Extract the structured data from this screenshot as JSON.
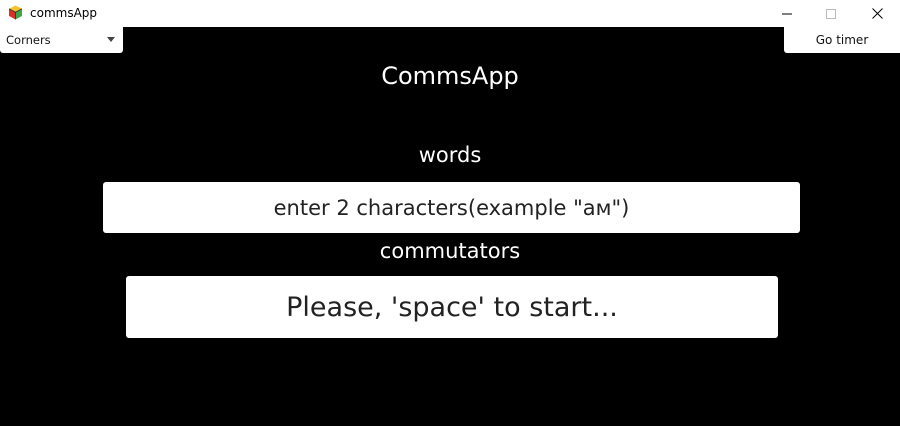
{
  "window": {
    "title": "commsApp",
    "icon": "app-cube-icon"
  },
  "toolbar": {
    "mode_select": {
      "selected": "Corners",
      "icon": "chevron-down-icon"
    },
    "timer_label": "Go timer"
  },
  "main": {
    "title": "CommsApp",
    "words_label": "words",
    "words_prompt": "enter 2 characters(example \"ам\")",
    "commutators_label": "commutators",
    "commutators_prompt": "Please, 'space' to start..."
  },
  "colors": {
    "background": "#000000",
    "panel": "#ffffff",
    "text_light": "#ffffff",
    "text_dark": "#222222"
  }
}
